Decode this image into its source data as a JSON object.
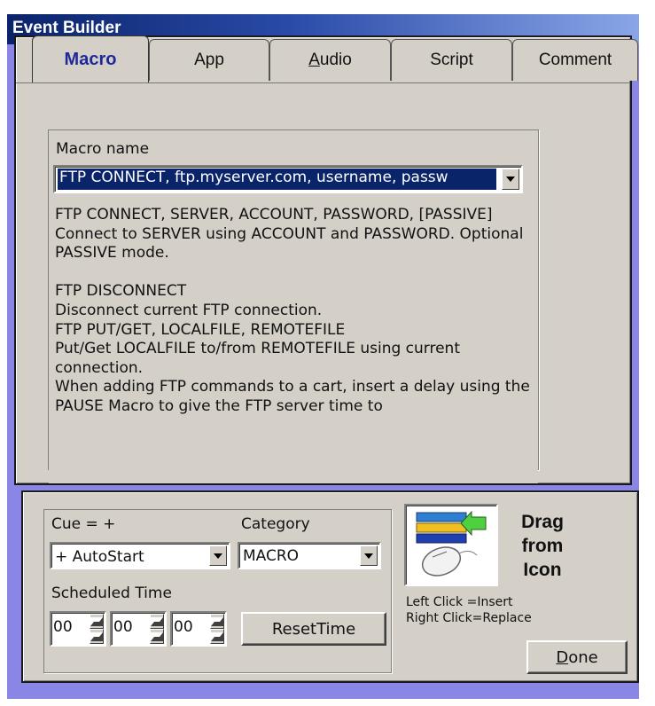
{
  "window": {
    "title": "Event Builder"
  },
  "tabs": [
    {
      "label": "Macro",
      "active": true
    },
    {
      "label": "App",
      "active": false
    },
    {
      "label_prefix": "",
      "label_underlined": "A",
      "label_rest": "udio",
      "active": false
    },
    {
      "label": "Script",
      "active": false
    },
    {
      "label": "Comment",
      "active": false
    }
  ],
  "macro": {
    "name_label": "Macro name",
    "selected_value": "FTP CONNECT, ftp.myserver.com, username, passw",
    "description": [
      "FTP CONNECT, SERVER, ACCOUNT, PASSWORD, [PASSIVE]",
      "Connect to SERVER using ACCOUNT and PASSWORD. Optional PASSIVE mode.",
      "",
      "FTP DISCONNECT",
      "Disconnect current FTP connection.",
      "FTP PUT/GET, LOCALFILE, REMOTEFILE",
      "Put/Get LOCALFILE to/from REMOTEFILE using current connection.",
      "When adding FTP commands to a cart, insert a delay using the PAUSE Macro to give the FTP server time to"
    ]
  },
  "cue": {
    "label": "Cue = +",
    "value": "+ AutoStart"
  },
  "category": {
    "label": "Category",
    "value": "MACRO"
  },
  "scheduled": {
    "label": "Scheduled Time",
    "hours": "00",
    "minutes": "00",
    "seconds": "00",
    "reset_label": "ResetTime"
  },
  "drag": {
    "text_lines": [
      "Drag",
      "from",
      "Icon"
    ],
    "left_click": "Left Click  =Insert",
    "right_click": "Right Click=Replace"
  },
  "done": {
    "underlined": "D",
    "rest": "one"
  },
  "colors": {
    "frame": "#8a86e6",
    "title_start": "#0a236a",
    "title_end": "#8aa6e8",
    "face": "#d4d0c8",
    "active_tab_text": "#1f2a9a",
    "selection": "#0a246a"
  }
}
